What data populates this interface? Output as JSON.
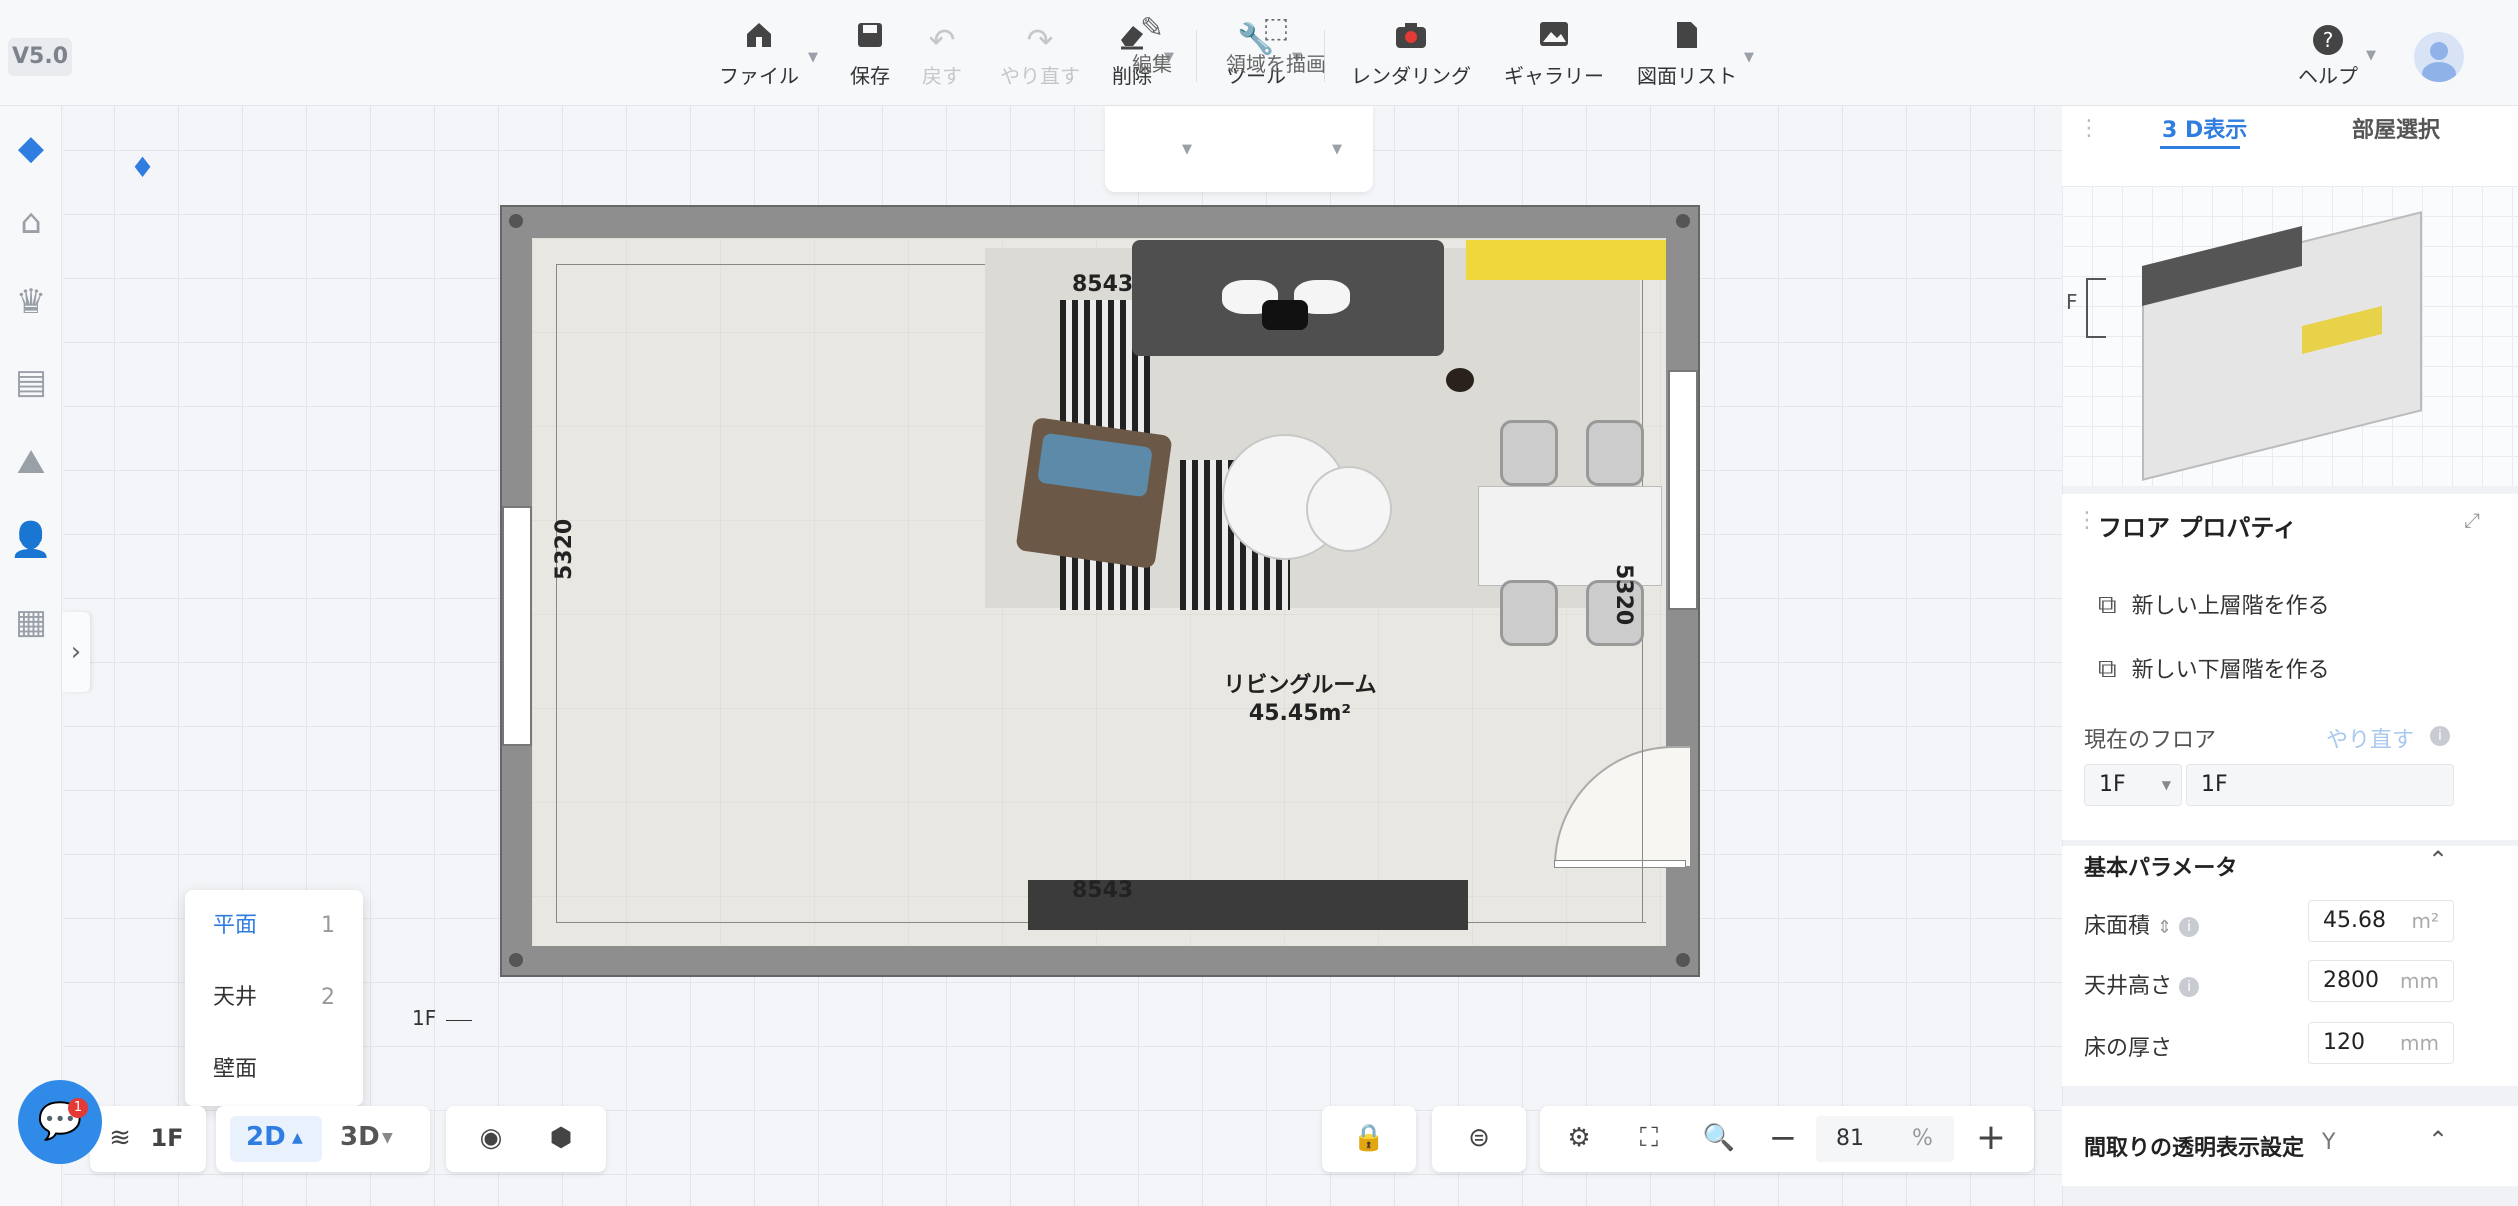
{
  "version": "V5.0",
  "toolbar": {
    "file": "ファイル",
    "save": "保存",
    "undo": "戻す",
    "redo": "やり直す",
    "delete": "削除",
    "tools": "ツール",
    "rendering": "レンダリング",
    "gallery": "ギャラリー",
    "drawing_list": "図面リスト",
    "help": "ヘルプ"
  },
  "edit_bar": {
    "edit": "編集",
    "draw_area": "領域を描画"
  },
  "floorplan": {
    "dim_top": "8543",
    "dim_bottom": "8543",
    "dim_left": "5320",
    "dim_right": "5320",
    "room_name": "リビングルーム",
    "room_area": "45.45m²",
    "floor_marker": "1F"
  },
  "view_menu": {
    "items": [
      {
        "label": "平面",
        "key": "1",
        "active": true
      },
      {
        "label": "天井",
        "key": "2",
        "active": false
      },
      {
        "label": "壁面",
        "key": "",
        "active": false
      }
    ]
  },
  "bottom_bar": {
    "floor": "1F",
    "view_2d": "2D",
    "view_3d": "3D",
    "zoom_value": "81",
    "zoom_unit": "%"
  },
  "chat": {
    "badge": "1"
  },
  "right_panel": {
    "tab_3d": "3 D表示",
    "tab_room": "部屋選択",
    "preview_floor": "F",
    "floor_props_title": "フロア プロパティ",
    "new_upper": "新しい上層階を作る",
    "new_lower": "新しい下層階を作る",
    "current_floor_label": "現在のフロア",
    "redo_link": "やり直す",
    "current_floor_select": "1F",
    "current_floor_name": "1F",
    "basic_params_title": "基本パラメータ",
    "floor_area_label": "床面積",
    "floor_area_value": "45.68",
    "floor_area_unit": "m²",
    "ceiling_height_label": "天井高さ",
    "ceiling_height_value": "2800",
    "ceiling_height_unit": "mm",
    "floor_thickness_label": "床の厚さ",
    "floor_thickness_value": "120",
    "floor_thickness_unit": "mm",
    "transparency_title": "間取りの透明表示設定",
    "transparency_value": "Y"
  },
  "colors": {
    "accent": "#2f7de1",
    "wall": "#8e8e8e",
    "floor": "#e9e7e2"
  },
  "icons": [
    "house-icon",
    "save-icon",
    "undo-icon",
    "redo-icon",
    "eraser-icon",
    "wrench-icon",
    "camera-icon",
    "picture-icon",
    "document-icon",
    "help-icon",
    "avatar-icon",
    "layers-icon",
    "eye-icon",
    "cube-icon",
    "lock-icon",
    "toggle-icon",
    "zoom-icon",
    "minus-icon",
    "plus-icon",
    "chat-icon"
  ]
}
